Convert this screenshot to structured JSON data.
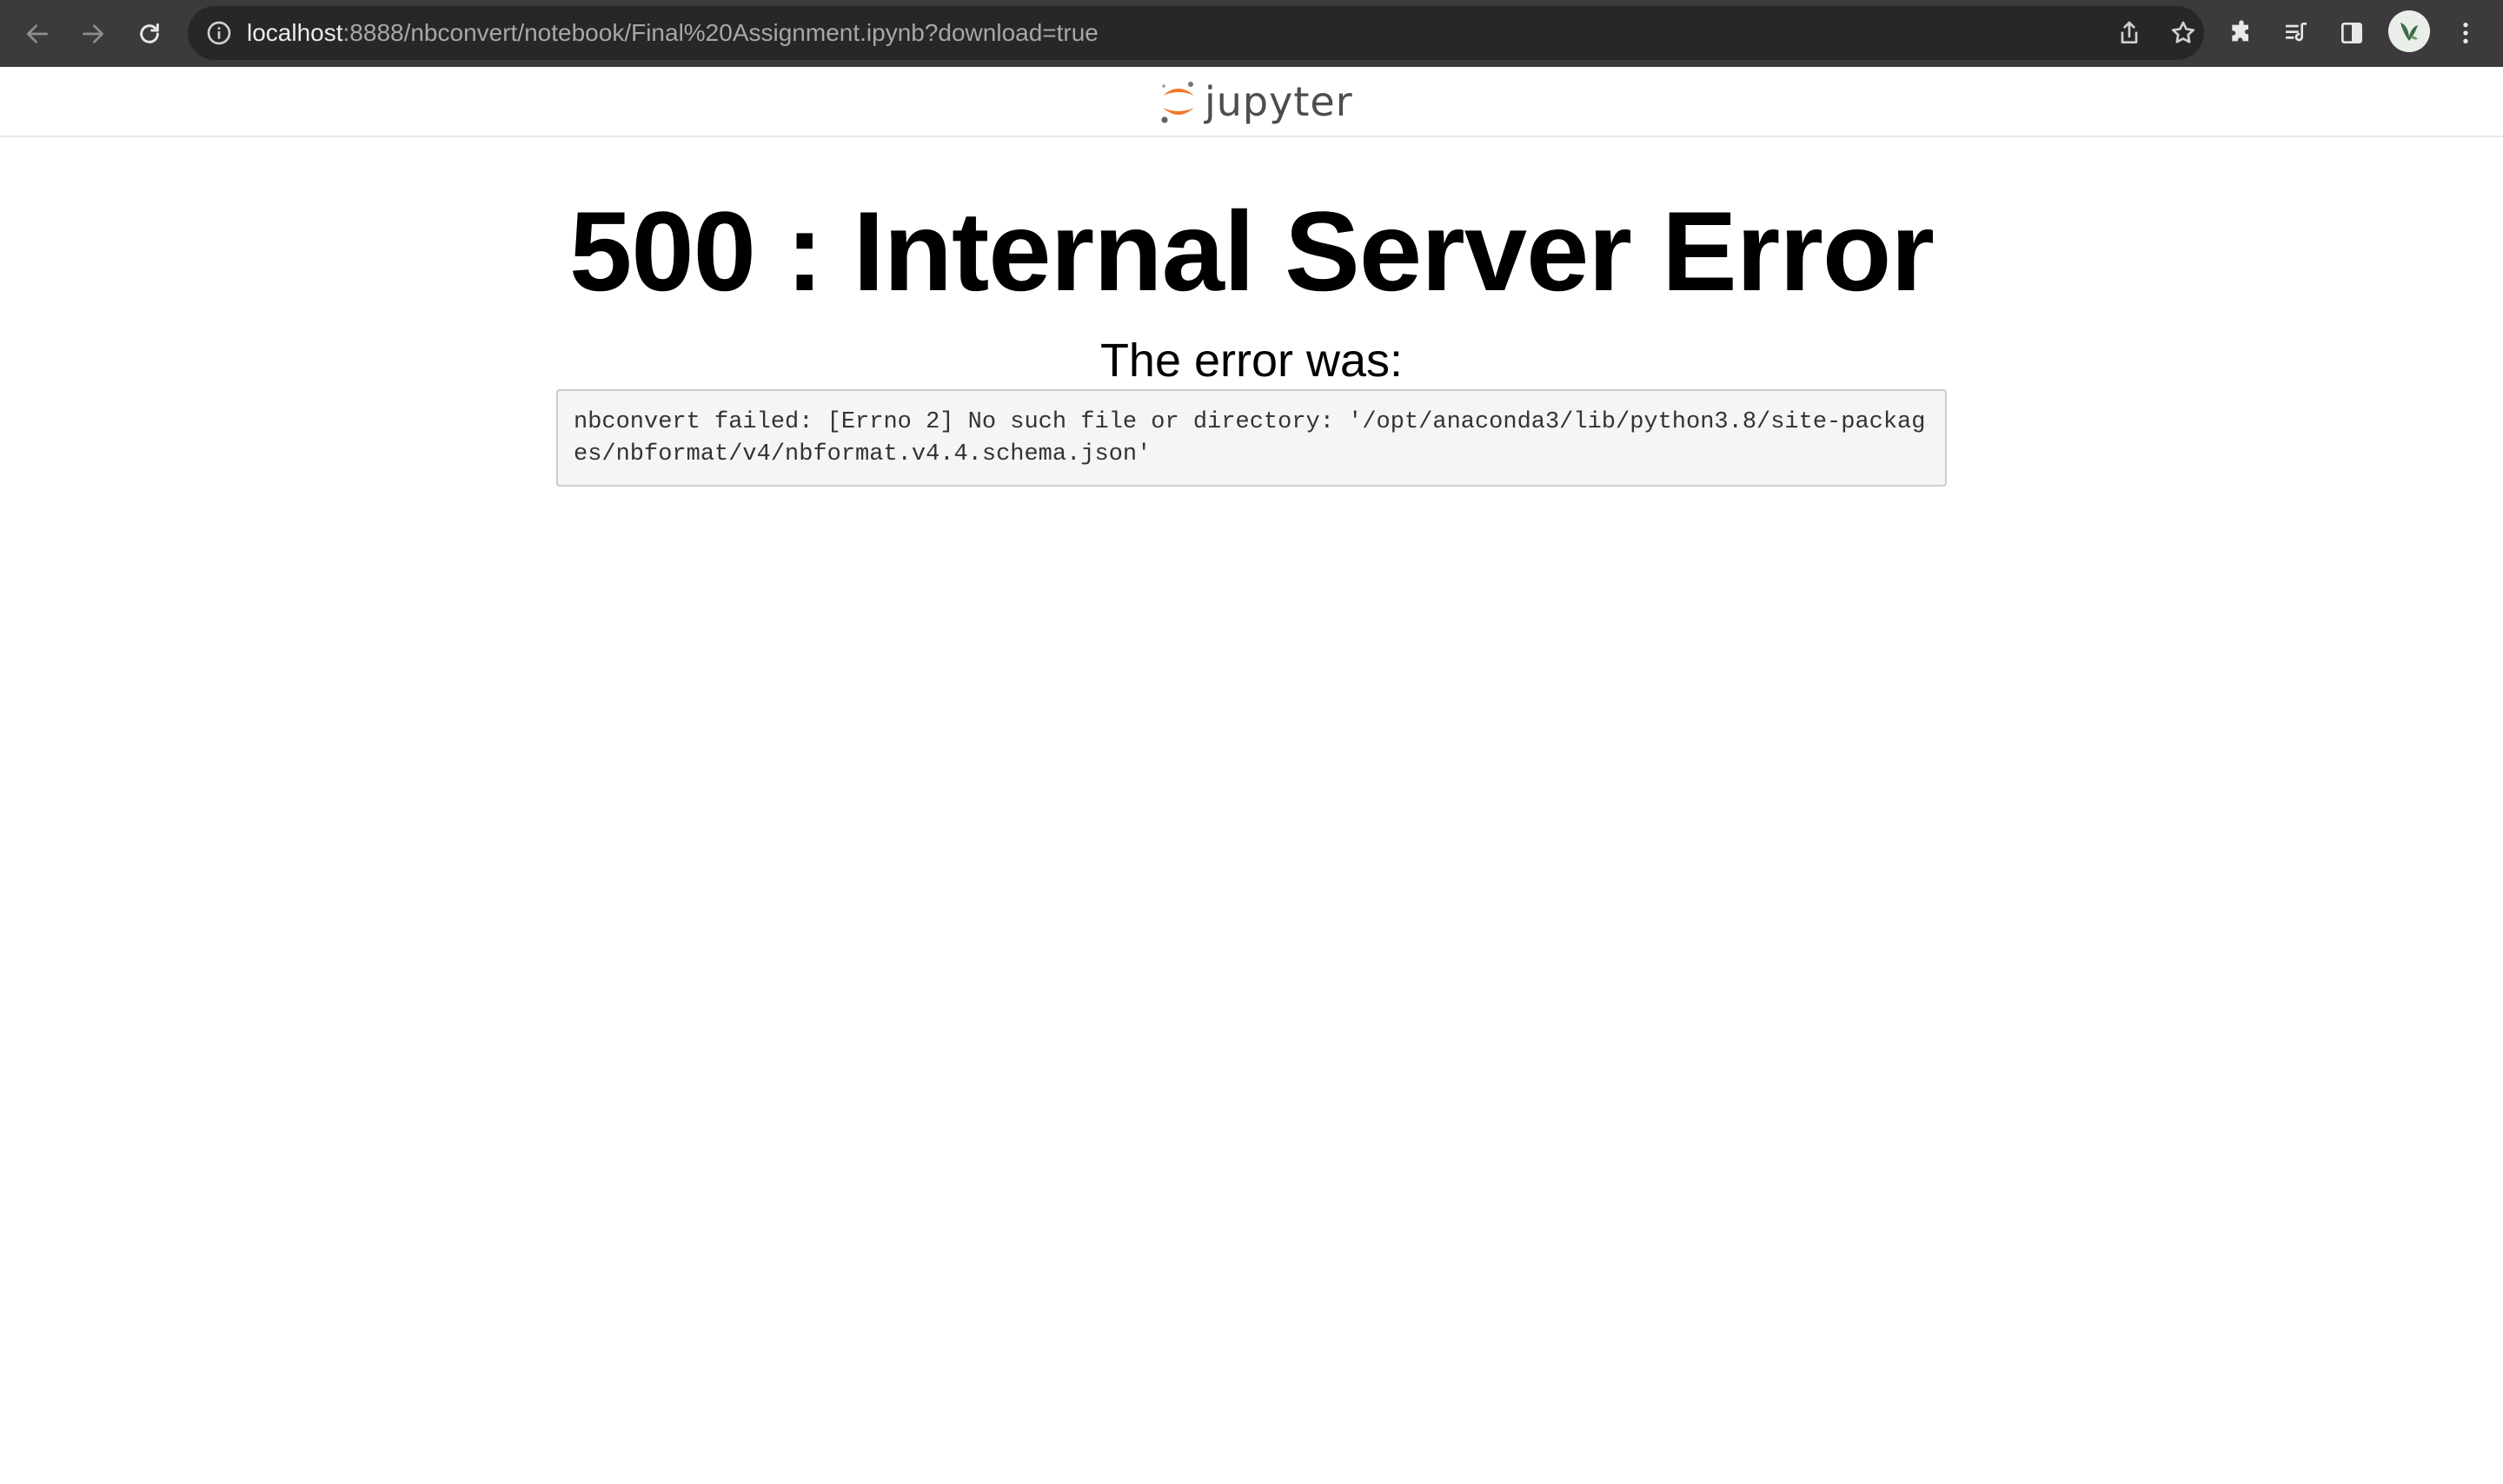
{
  "browser": {
    "url_host": "localhost",
    "url_rest": ":8888/nbconvert/notebook/Final%20Assignment.ipynb?download=true",
    "icons": {
      "back": "arrow-left-icon",
      "forward": "arrow-right-icon",
      "reload": "reload-icon",
      "site_info": "info-icon",
      "share": "share-icon",
      "bookmark": "star-icon",
      "extensions": "puzzle-icon",
      "reading_list": "reading-list-icon",
      "side_panel": "side-panel-icon",
      "menu": "more-vert-icon"
    }
  },
  "page": {
    "logo_text": "jupyter",
    "title": "500 : Internal Server Error",
    "subtitle": "The error was:",
    "error_message": "nbconvert failed: [Errno 2] No such file or directory: '/opt/anaconda3/lib/python3.8/site-packages/nbformat/v4/nbformat.v4.4.schema.json'"
  },
  "colors": {
    "toolbar_bg": "#3c3a3c",
    "omnibox_bg": "#282628",
    "jupyter_orange": "#f37726",
    "jupyter_gray": "#767677"
  }
}
